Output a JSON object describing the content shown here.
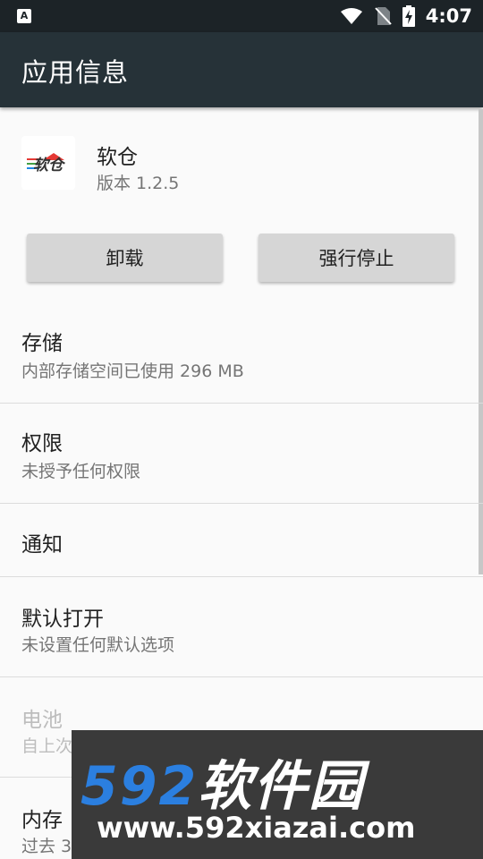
{
  "status_bar": {
    "left_icon": "A",
    "time": "4:07",
    "icons": [
      "wifi-icon",
      "no-sim-icon",
      "battery-charging-icon"
    ]
  },
  "app_bar": {
    "title": "应用信息"
  },
  "app": {
    "name": "软仓",
    "version": "版本 1.2.5",
    "icon_text": "软仓"
  },
  "buttons": {
    "uninstall": "卸载",
    "force_stop": "强行停止"
  },
  "rows": {
    "storage": {
      "title": "存储",
      "subtitle": "内部存储空间已使用 296 MB"
    },
    "permissions": {
      "title": "权限",
      "subtitle": "未授予任何权限"
    },
    "notifications": {
      "title": "通知"
    },
    "open_by_default": {
      "title": "默认打开",
      "subtitle": "未设置任何默认选项"
    },
    "battery": {
      "title": "电池",
      "subtitle": "自上次"
    },
    "memory": {
      "title": "内存",
      "subtitle": "过去 3"
    }
  },
  "watermark": {
    "number": "592",
    "brand": "软件园",
    "url": "www.592xiazai.com"
  },
  "colors": {
    "status_bar": "#1c2327",
    "app_bar": "#263238",
    "background": "#fafafa",
    "button": "#d6d6d6",
    "watermark_blue": "#2b7fe0"
  }
}
